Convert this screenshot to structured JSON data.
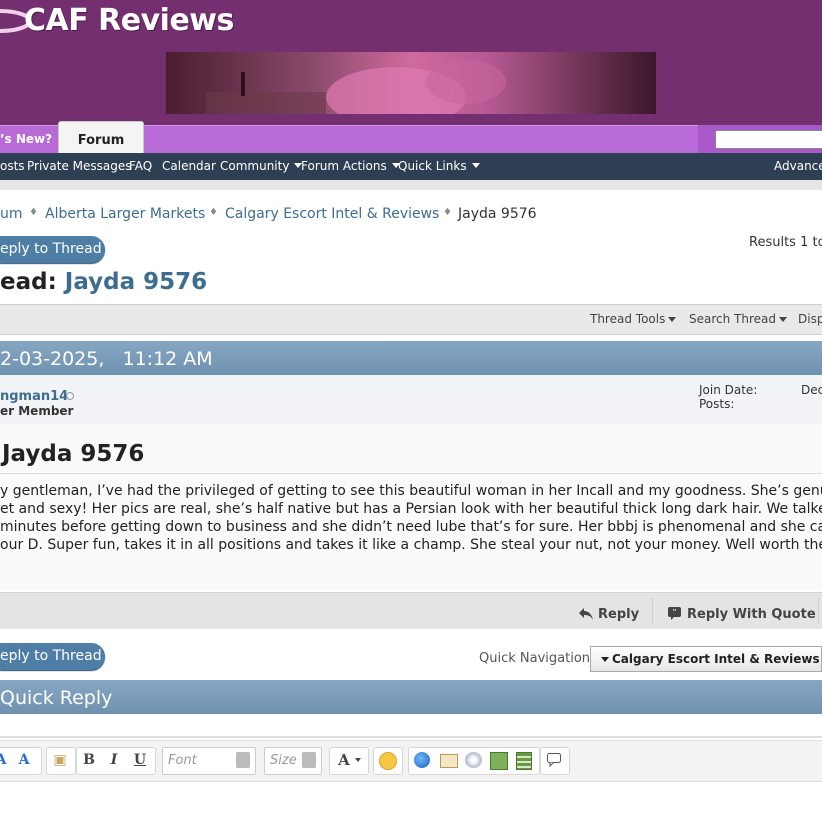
{
  "header": {
    "logo_text": "CAF Reviews",
    "banner_alt": "site banner image"
  },
  "tabs": {
    "whats_new": "’s New?",
    "forum": "Forum"
  },
  "search": {
    "placeholder": ""
  },
  "nav": {
    "items": [
      "osts",
      "Private Messages",
      "FAQ",
      "Calendar",
      "Community",
      "Forum Actions",
      "Quick Links"
    ],
    "advanced": "Advanced"
  },
  "breadcrumb": {
    "items": [
      "um",
      "Alberta Larger Markets",
      "Calgary Escort Intel & Reviews"
    ],
    "current": "Jayda 9576"
  },
  "thread": {
    "reply_button": "eply to Thread",
    "results": "Results 1 to",
    "title_prefix": "ead:",
    "title": "Jayda 9576",
    "tools": [
      "Thread Tools",
      "Search Thread",
      "Disp"
    ]
  },
  "post": {
    "date": "2-03-2025,",
    "time": "11:12 AM",
    "username": "ngman14",
    "user_title": "er Member",
    "join_date_label": "Join Date:",
    "join_date_value": "Dec",
    "posts_label": "Posts:",
    "title": "Jayda 9576",
    "body_lines": [
      "y gentleman, I’ve had the privileged of getting to see this beautiful woman in her Incall and my goodness. She’s genuine",
      "et and sexy! Her pics are real, she’s half native but has a Persian look with her beautiful thick long dark hair. We talked fo",
      "minutes before getting down to business and she didn’t need lube that’s for sure. Her bbbj is phenomenal and she can tw",
      "our D. Super fun, takes it in all positions and takes it like a champ. She steal your nut, not your money. Well worth the p"
    ],
    "reply": "Reply",
    "reply_with_quote": "Reply With Quote"
  },
  "quick_nav": {
    "label": "Quick Navigation",
    "selected": "Calgary Escort Intel & Reviews"
  },
  "quick_reply": {
    "title": "Quick Reply",
    "font_placeholder": "Font",
    "size_placeholder": "Size"
  },
  "colors": {
    "header_purple": "#732f6f",
    "tab_purple": "#b86bd6",
    "nav_dark": "#2f3f53",
    "link_blue": "#3e6d8f",
    "button_blue": "#4e7ea5",
    "post_header": "#7a9cb8"
  },
  "icons": [
    "search-icon",
    "reply-icon",
    "quote-icon",
    "bold-icon",
    "italic-icon",
    "underline-icon",
    "smiley-icon",
    "link-icon",
    "email-icon",
    "image-icon",
    "video-icon",
    "quote-block-icon"
  ]
}
